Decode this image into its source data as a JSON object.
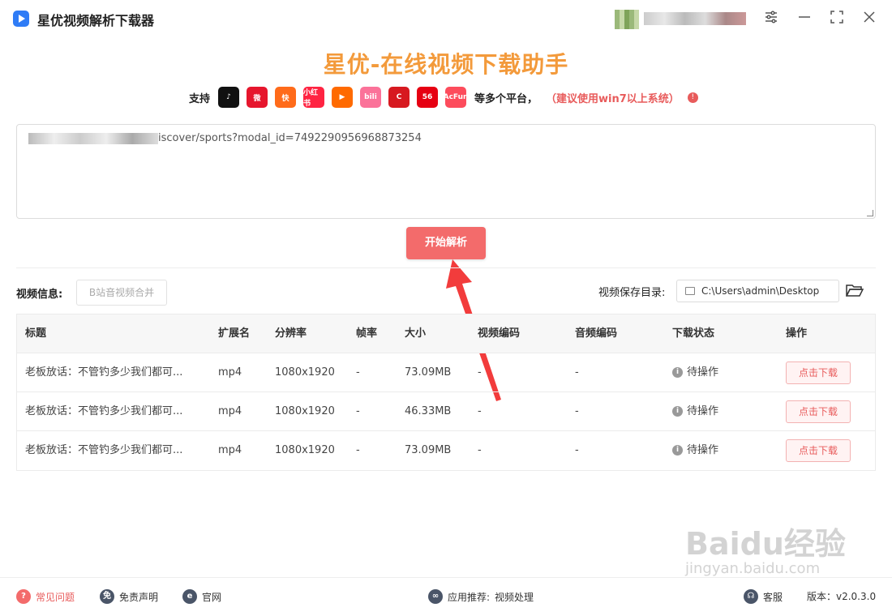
{
  "app": {
    "title": "星优视频解析下载器"
  },
  "titlebar_icons": [
    "settings-sliders-icon",
    "minimize-icon",
    "maximize-icon",
    "close-icon"
  ],
  "slogan": "星优-在线视频下载助手",
  "platforms": {
    "label": "支持",
    "icons": [
      {
        "name": "tiktok",
        "text": "♪",
        "color": "#111111"
      },
      {
        "name": "weibo",
        "text": "微",
        "color": "#e6162d"
      },
      {
        "name": "kuaishou",
        "text": "快",
        "color": "#ff6b1a"
      },
      {
        "name": "xiaohongshu",
        "text": "小红书",
        "color": "#ff2442"
      },
      {
        "name": "tencent-video",
        "text": "▶",
        "color": "#ff6a00"
      },
      {
        "name": "bilibili",
        "text": "bili",
        "color": "#fb7299"
      },
      {
        "name": "cctv",
        "text": "C",
        "color": "#d71920"
      },
      {
        "name": "56",
        "text": "56",
        "color": "#e60012"
      },
      {
        "name": "acfun",
        "text": "AcFun",
        "color": "#fd4c5c"
      }
    ],
    "more": "等多个平台，",
    "note": "（建议使用win7以上系统）"
  },
  "url_input": {
    "value_suffix": "iscover/sports?modal_id=7492290956968873254"
  },
  "parse_button": "开始解析",
  "video_info": {
    "label": "视频信息:",
    "merge_button": "B站音视频合并"
  },
  "save_dir": {
    "label": "视频保存目录:",
    "path": "C:\\Users\\admin\\Desktop"
  },
  "table": {
    "headers": [
      "标题",
      "扩展名",
      "分辨率",
      "帧率",
      "大小",
      "视频编码",
      "音频编码",
      "下载状态",
      "操作"
    ],
    "rows": [
      {
        "title": "老板放话：不管钓多少我们都可...",
        "ext": "mp4",
        "res": "1080x1920",
        "fps": "-",
        "size": "73.09MB",
        "vcodec": "-",
        "acodec": "-",
        "status": "待操作",
        "action": "点击下载"
      },
      {
        "title": "老板放话：不管钓多少我们都可...",
        "ext": "mp4",
        "res": "1080x1920",
        "fps": "-",
        "size": "46.33MB",
        "vcodec": "-",
        "acodec": "-",
        "status": "待操作",
        "action": "点击下载"
      },
      {
        "title": "老板放话：不管钓多少我们都可...",
        "ext": "mp4",
        "res": "1080x1920",
        "fps": "-",
        "size": "73.09MB",
        "vcodec": "-",
        "acodec": "-",
        "status": "待操作",
        "action": "点击下载"
      }
    ]
  },
  "footer": {
    "faq": "常见问题",
    "disclaimer": "免责声明",
    "website": "官网",
    "recommend_label": "应用推荐:",
    "recommend_value": "视频处理",
    "support": "客服",
    "version": "版本：v2.0.3.0"
  },
  "watermark": {
    "main": "Baidu经验",
    "sub": "jingyan.baidu.com"
  }
}
